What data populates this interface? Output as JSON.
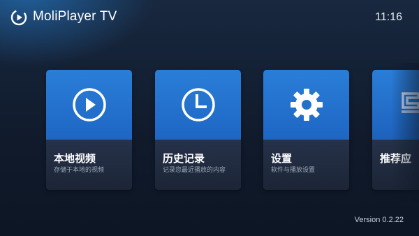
{
  "header": {
    "app_name": "MoliPlayer TV",
    "logo_icon": "play-logo-icon",
    "time": "11:16"
  },
  "cards": [
    {
      "title": "本地视频",
      "subtitle": "存储于本地的视频",
      "icon": "play-circle-icon"
    },
    {
      "title": "历史记录",
      "subtitle": "记录您最近播放的内容",
      "icon": "clock-icon"
    },
    {
      "title": "设置",
      "subtitle": "软件与播放设置",
      "icon": "gear-icon"
    },
    {
      "title": "推荐应",
      "subtitle": "",
      "icon": "recommend-icon"
    }
  ],
  "footer": {
    "version": "Version 0.2.22"
  },
  "colors": {
    "card_accent": "#2a7ed8",
    "background": "#101a2b"
  }
}
